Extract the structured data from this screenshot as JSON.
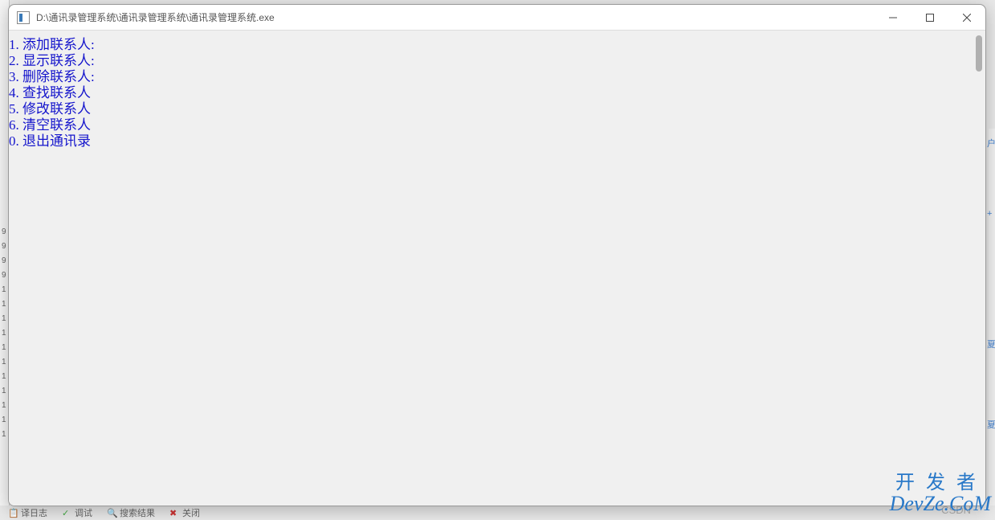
{
  "window": {
    "title": "D:\\通讯录管理系统\\通讯录管理系统\\通讯录管理系统.exe"
  },
  "menu": {
    "items": [
      "1. 添加联系人:",
      "2. 显示联系人:",
      "3. 删除联系人:",
      "4. 查找联系人",
      "5. 修改联系人",
      "6. 清空联系人",
      "0. 退出通讯录"
    ]
  },
  "background": {
    "status_items": [
      "译日志",
      "调试",
      "搜索结果",
      "关闭"
    ],
    "gutter_numbers": [
      "9",
      "9",
      "9",
      "9",
      "1",
      "1",
      "1",
      "1",
      "1",
      "1",
      "1",
      "1",
      "1",
      "1",
      "1"
    ],
    "right_markers": [
      "户",
      "+",
      "夏",
      "夏"
    ]
  },
  "watermarks": {
    "csdn": "CSDN",
    "devze": "DevZe.CoM",
    "kaifa": "开发者"
  }
}
